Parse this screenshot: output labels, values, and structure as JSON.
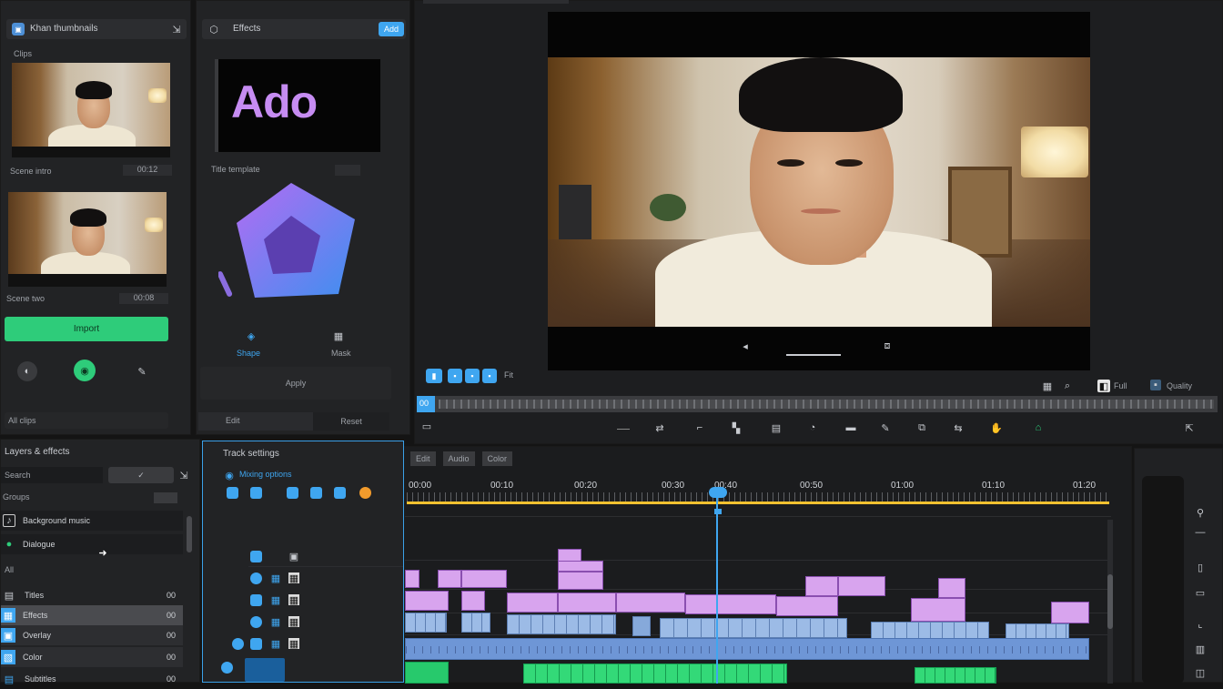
{
  "media_panel": {
    "header_title": "Khan thumbnails",
    "header_icon": "image-icon",
    "section_label": "Clips",
    "thumb1_caption": "Scene intro",
    "thumb1_time": "00:12",
    "thumb2_caption": "Scene two",
    "thumb2_time": "00:08",
    "import_button": "Import",
    "footer_label": "All clips"
  },
  "effects_panel": {
    "header_title": "Effects",
    "header_button": "Add",
    "title_card_text": "Ado",
    "title_card_caption": "Title template",
    "shape_caption_left": "Shape",
    "shape_caption_right": "Mask",
    "apply_label": "Apply",
    "tab_left": "Edit",
    "tab_right": "Reset"
  },
  "viewer": {
    "zoom_label": "Fit",
    "right_label_1": "Full",
    "right_label_2": "Quality",
    "playhead_chip": "00"
  },
  "layers_panel": {
    "title": "Layers & effects",
    "search_placeholder": "Search",
    "group_label": "Groups",
    "row1": "Background music",
    "row2": "Dialogue",
    "row3": "All",
    "items": [
      {
        "label": "Titles",
        "badge": "00"
      },
      {
        "label": "Effects",
        "badge": "00"
      },
      {
        "label": "Overlay",
        "badge": "00"
      },
      {
        "label": "Color",
        "badge": "00"
      },
      {
        "label": "Subtitles",
        "badge": "00"
      }
    ]
  },
  "tracks_panel": {
    "title": "Track settings",
    "subtitle": "Mixing options"
  },
  "timeline": {
    "tabs": [
      "Edit",
      "Audio",
      "Color"
    ],
    "ruler_labels": [
      "00:00",
      "00:10",
      "00:20",
      "00:30",
      "00:40",
      "00:50",
      "01:00",
      "01:10",
      "01:20"
    ],
    "playhead_position": 0.43
  },
  "colors": {
    "accent_blue": "#3fa6f0",
    "accent_green": "#2ecc7a",
    "clip_purple": "#d8a4ee",
    "clip_blue": "#86a9da",
    "clip_green": "#27c96c",
    "ruler_yellow": "#f2c230"
  }
}
